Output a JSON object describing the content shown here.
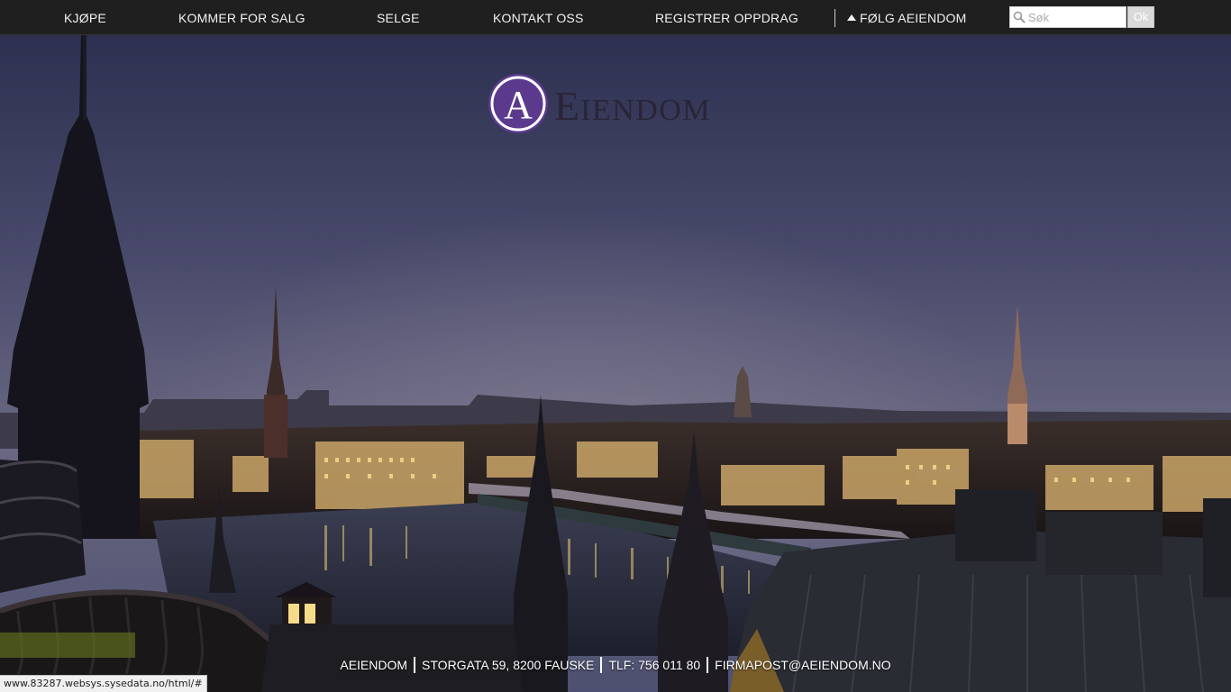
{
  "nav": {
    "items": [
      {
        "label": "KJØPE"
      },
      {
        "label": "KOMMER FOR SALG"
      },
      {
        "label": "SELGE"
      },
      {
        "label": "KONTAKT OSS"
      },
      {
        "label": "REGISTRER OPPDRAG"
      }
    ],
    "follow_label": "FØLG AEIENDOM",
    "follow_icon": "triangle-up-icon"
  },
  "search": {
    "placeholder": "Søk",
    "button_label": "Ok",
    "icon": "search-icon"
  },
  "logo": {
    "monogram": "A",
    "wordmark_initial": "E",
    "wordmark_rest": "IENDOM",
    "colors": {
      "circle": "#5b3a8e",
      "ring": "#ffffff",
      "text": "#2a2438"
    }
  },
  "footer": {
    "company": "AEIENDOM",
    "address": "STORGATA 59, 8200 FAUSKE",
    "phone": "TLF: 756 011 80",
    "email": "FIRMAPOST@AEIENDOM.NO"
  },
  "status_bar": {
    "url": "www.83287.websys.sysedata.no/html/#"
  },
  "colors": {
    "nav_bg": "#1f1f1f",
    "nav_text": "#f2f2f2",
    "sky_top": "#2e3152",
    "sky_mid": "#5b5a78",
    "water": "#2b2f40"
  }
}
